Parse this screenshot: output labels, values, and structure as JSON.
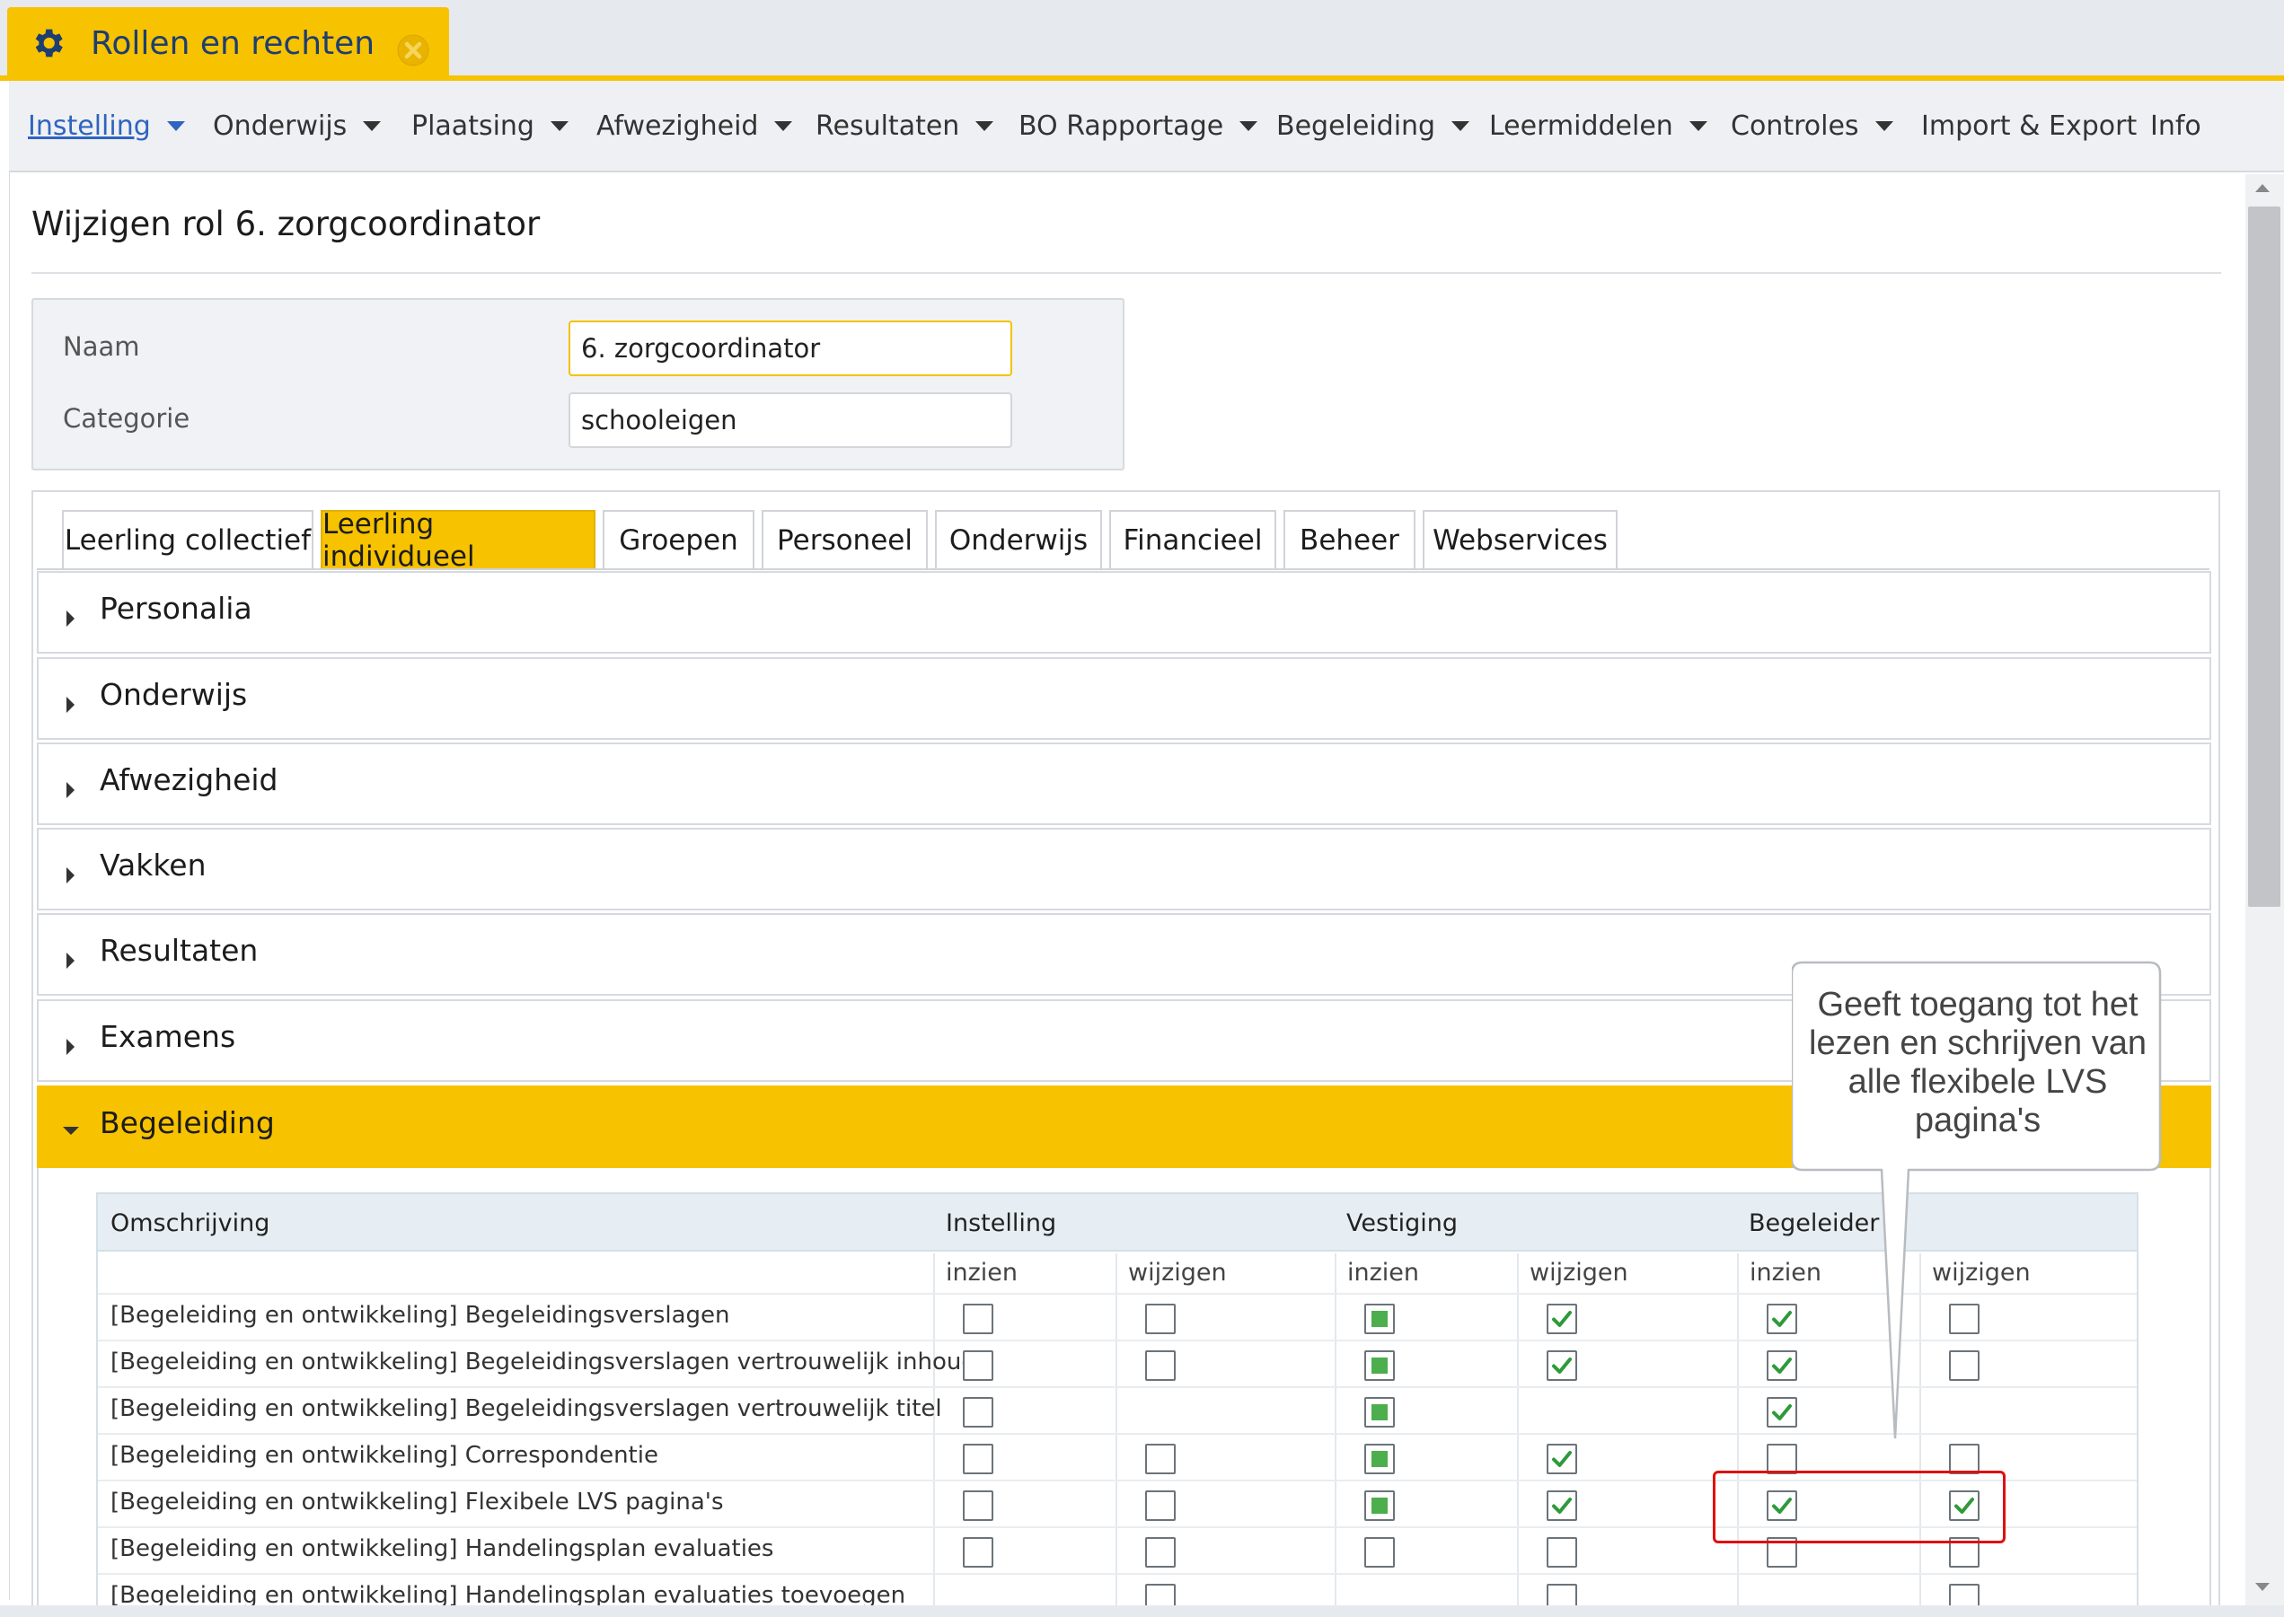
{
  "window_tab": {
    "title": "Rollen en rechten",
    "icon": "gear-icon",
    "close_icon": "close-icon"
  },
  "menu": {
    "items": [
      {
        "label": "Instelling",
        "has_dropdown": true,
        "active": true
      },
      {
        "label": "Onderwijs",
        "has_dropdown": true
      },
      {
        "label": "Plaatsing",
        "has_dropdown": true
      },
      {
        "label": "Afwezigheid",
        "has_dropdown": true
      },
      {
        "label": "Resultaten",
        "has_dropdown": true
      },
      {
        "label": "BO Rapportage",
        "has_dropdown": true
      },
      {
        "label": "Begeleiding",
        "has_dropdown": true
      },
      {
        "label": "Leermiddelen",
        "has_dropdown": true
      },
      {
        "label": "Controles",
        "has_dropdown": true
      },
      {
        "label": "Import & Export",
        "has_dropdown": false
      },
      {
        "label": "Info",
        "has_dropdown": false
      }
    ]
  },
  "page": {
    "title": "Wijzigen rol 6. zorgcoordinator"
  },
  "form": {
    "naam_label": "Naam",
    "naam_value": "6. zorgcoordinator",
    "categorie_label": "Categorie",
    "categorie_value": "schooleigen"
  },
  "tabs": [
    {
      "label": "Leerling collectief"
    },
    {
      "label": "Leerling individueel",
      "active": true
    },
    {
      "label": "Groepen"
    },
    {
      "label": "Personeel"
    },
    {
      "label": "Onderwijs"
    },
    {
      "label": "Financieel"
    },
    {
      "label": "Beheer"
    },
    {
      "label": "Webservices"
    }
  ],
  "sections": [
    {
      "label": "Personalia",
      "expanded": false
    },
    {
      "label": "Onderwijs",
      "expanded": false
    },
    {
      "label": "Afwezigheid",
      "expanded": false
    },
    {
      "label": "Vakken",
      "expanded": false
    },
    {
      "label": "Resultaten",
      "expanded": false
    },
    {
      "label": "Examens",
      "expanded": false
    },
    {
      "label": "Begeleiding",
      "expanded": true
    }
  ],
  "permissions_table": {
    "headers": {
      "description": "Omschrijving",
      "instelling": "Instelling",
      "vestiging": "Vestiging",
      "begeleider": "Begeleider"
    },
    "sub_headers": {
      "view": "inzien",
      "edit": "wijzigen"
    },
    "rows": [
      {
        "description": "[Begeleiding en ontwikkeling] Begeleidingsverslagen",
        "values": [
          "unchecked",
          "unchecked",
          "partial",
          "checked",
          "checked",
          "unchecked"
        ]
      },
      {
        "description": "[Begeleiding en ontwikkeling] Begeleidingsverslagen vertrouwelijk inhoud",
        "values": [
          "unchecked",
          "unchecked",
          "partial",
          "checked",
          "checked",
          "unchecked"
        ]
      },
      {
        "description": "[Begeleiding en ontwikkeling] Begeleidingsverslagen vertrouwelijk titel",
        "values": [
          "unchecked",
          null,
          "partial",
          null,
          "checked",
          null
        ]
      },
      {
        "description": "[Begeleiding en ontwikkeling] Correspondentie",
        "values": [
          "unchecked",
          "unchecked",
          "partial",
          "checked",
          "unchecked",
          "unchecked"
        ]
      },
      {
        "description": "[Begeleiding en ontwikkeling] Flexibele LVS pagina's",
        "values": [
          "unchecked",
          "unchecked",
          "partial",
          "checked",
          "checked",
          "checked"
        ]
      },
      {
        "description": "[Begeleiding en ontwikkeling] Handelingsplan evaluaties",
        "values": [
          "unchecked",
          "unchecked",
          "unchecked",
          "unchecked",
          "unchecked",
          "unchecked"
        ]
      },
      {
        "description": "[Begeleiding en ontwikkeling] Handelingsplan evaluaties toevoegen",
        "values": [
          null,
          "unchecked",
          null,
          "unchecked",
          null,
          "unchecked"
        ]
      }
    ]
  },
  "callout": {
    "text": "Geeft toegang tot het lezen en schrijven van alle flexibele LVS pagina's"
  },
  "colors": {
    "accent": "#f7c200",
    "brand_text": "#1d3e71",
    "link_active": "#2f64c0",
    "check_green": "#2e9a3a",
    "highlight_red": "#e01010"
  }
}
